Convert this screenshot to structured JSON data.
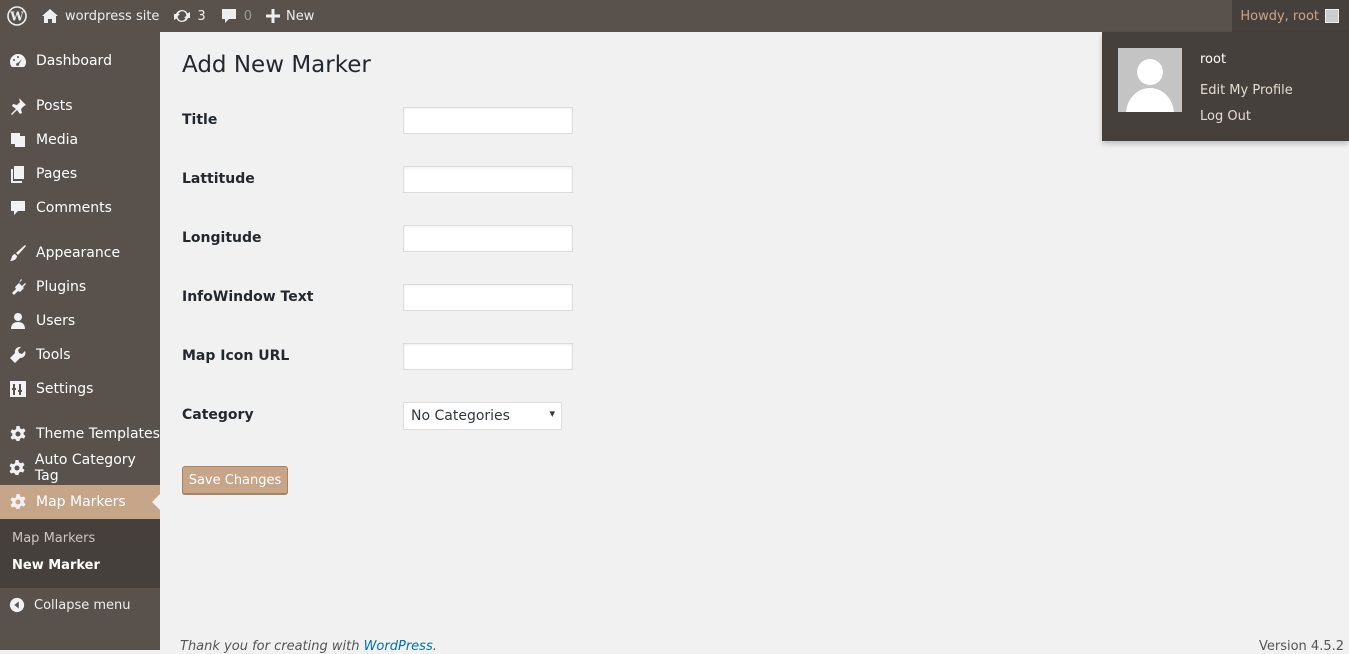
{
  "adminbar": {
    "site_name": "wordpress site",
    "updates_count": "3",
    "comments_count": "0",
    "new_label": "New",
    "howdy": "Howdy, root"
  },
  "user_menu": {
    "name": "root",
    "edit_profile": "Edit My Profile",
    "logout": "Log Out"
  },
  "sidebar": {
    "items": [
      {
        "label": "Dashboard",
        "icon": "dashboard-icon"
      },
      {
        "label": "Posts",
        "icon": "pin-icon"
      },
      {
        "label": "Media",
        "icon": "media-icon"
      },
      {
        "label": "Pages",
        "icon": "pages-icon"
      },
      {
        "label": "Comments",
        "icon": "comment-icon"
      },
      {
        "label": "Appearance",
        "icon": "brush-icon"
      },
      {
        "label": "Plugins",
        "icon": "plugin-icon"
      },
      {
        "label": "Users",
        "icon": "user-icon"
      },
      {
        "label": "Tools",
        "icon": "wrench-icon"
      },
      {
        "label": "Settings",
        "icon": "settings-icon"
      },
      {
        "label": "Theme Templates",
        "icon": "gear-icon"
      },
      {
        "label": "Auto Category Tag",
        "icon": "gear-icon"
      },
      {
        "label": "Map Markers",
        "icon": "gear-icon"
      }
    ],
    "submenu": [
      "Map Markers",
      "New Marker"
    ],
    "collapse": "Collapse menu"
  },
  "form": {
    "title": "Add New Marker",
    "fields": [
      {
        "label": "Title",
        "value": ""
      },
      {
        "label": "Lattitude",
        "value": ""
      },
      {
        "label": "Longitude",
        "value": ""
      },
      {
        "label": "InfoWindow Text",
        "value": ""
      },
      {
        "label": "Map Icon URL",
        "value": ""
      }
    ],
    "category_label": "Category",
    "category_value": "No Categories",
    "save": "Save Changes"
  },
  "footer": {
    "thanks": "Thank you for creating with ",
    "wp_link": "WordPress",
    "thanks_end": ".",
    "version": "Version 4.5.2"
  },
  "colors": {
    "adminbar": "#59524c",
    "submenu": "#46403c",
    "accent": "#c7a589"
  }
}
